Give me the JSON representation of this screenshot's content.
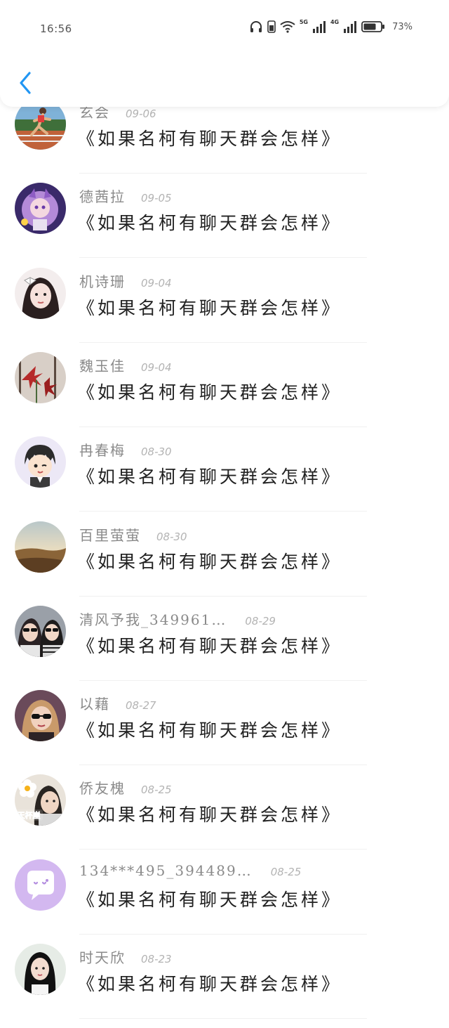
{
  "status_bar": {
    "time": "16:56",
    "net1": "5G",
    "net2": "4G",
    "battery": "73%"
  },
  "header": {
    "back_icon": "chevron-left-icon",
    "accent_color": "#2196f3"
  },
  "items": [
    {
      "name": "玄会",
      "date": "09-06",
      "title": "《如果名柯有聊天群会怎样》",
      "avatar": "runner"
    },
    {
      "name": "德茜拉",
      "date": "09-05",
      "title": "《如果名柯有聊天群会怎样》",
      "avatar": "anime-purple"
    },
    {
      "name": "机诗珊",
      "date": "09-04",
      "title": "《如果名柯有聊天群会怎样》",
      "avatar": "girl-bow"
    },
    {
      "name": "魏玉佳",
      "date": "09-04",
      "title": "《如果名柯有聊天群会怎样》",
      "avatar": "red-flower"
    },
    {
      "name": "冉春梅",
      "date": "08-30",
      "title": "《如果名柯有聊天群会怎样》",
      "avatar": "cartoon-boy"
    },
    {
      "name": "百里萤萤",
      "date": "08-30",
      "title": "《如果名柯有聊天群会怎样》",
      "avatar": "landscape"
    },
    {
      "name": "清风予我_349961…",
      "date": "08-29",
      "title": "《如果名柯有聊天群会怎样》",
      "avatar": "couple"
    },
    {
      "name": "以藉",
      "date": "08-27",
      "title": "《如果名柯有聊天群会怎样》",
      "avatar": "sunglasses-girl"
    },
    {
      "name": "侨友槐",
      "date": "08-25",
      "title": "《如果名柯有聊天群会怎样》",
      "avatar": "flower-boy"
    },
    {
      "name": "134***495_394489…",
      "date": "08-25",
      "title": "《如果名柯有聊天群会怎样》",
      "avatar": "chat-bubble"
    },
    {
      "name": "时天欣",
      "date": "08-23",
      "title": "《如果名柯有聊天群会怎样》",
      "avatar": "long-hair-girl"
    }
  ],
  "avatar_text": {
    "flower-boy": "天杯崖"
  }
}
